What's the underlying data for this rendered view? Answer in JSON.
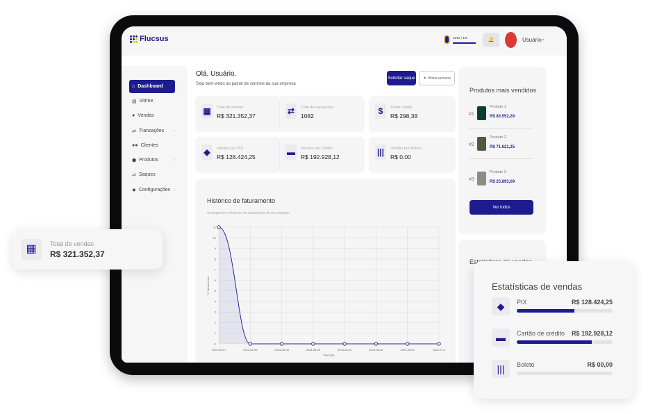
{
  "app": {
    "name": "Flucsus"
  },
  "header": {
    "goal": "321K / 1M",
    "goal_progress": 0.321,
    "user": "Usuário"
  },
  "sidebar": {
    "items": [
      {
        "label": "Dashboard",
        "icon": "home-icon",
        "active": true
      },
      {
        "label": "Vitrine",
        "icon": "store-icon"
      },
      {
        "label": "Vendas",
        "icon": "bag-icon"
      },
      {
        "label": "Transações",
        "icon": "transfer-icon",
        "expandable": true
      },
      {
        "label": "Clientes",
        "icon": "users-icon"
      },
      {
        "label": "Produtos",
        "icon": "box-icon",
        "expandable": true
      },
      {
        "label": "Saques",
        "icon": "transfer-icon"
      },
      {
        "label": "Configurações",
        "icon": "gear-icon",
        "expandable": true
      }
    ]
  },
  "main": {
    "greeting": "Olá, Usuário.",
    "subtitle": "Seja bem-vindo ao painel de controle da sua empresa",
    "withdraw_label": "Solicitar saque",
    "filter_label": "Última semana",
    "stats": [
      {
        "label": "Total de vendas",
        "value": "R$ 321.352,37",
        "icon": "cash-register-icon"
      },
      {
        "label": "Total de transações",
        "value": "1082",
        "icon": "transfer-icon"
      },
      {
        "label": "Ticket médio",
        "value": "R$ 298,38",
        "icon": "dollar-icon"
      },
      {
        "label": "Vendas por PIX",
        "value": "R$ 128.424,25",
        "icon": "pix-icon"
      },
      {
        "label": "Vendas por Cartão",
        "value": "R$ 192.928,12",
        "icon": "credit-card-icon"
      },
      {
        "label": "Vendas por Boleto",
        "value": "R$ 0.00",
        "icon": "barcode-icon"
      }
    ]
  },
  "chart_data": {
    "type": "line",
    "title": "Histórico de faturamento",
    "subtitle": "Acompanhe o histórico de transações do seu negócio",
    "xlabel": "Período",
    "ylabel": "Nº faturamento",
    "x": [
      "2024-08-07",
      "2024-08-06",
      "2024-08-05",
      "2024-08-04",
      "2024-08-03",
      "2024-08-02",
      "2024-08-01",
      "2024-07-3"
    ],
    "values": [
      11,
      0,
      0,
      0,
      0,
      0,
      0,
      0
    ],
    "ylim": [
      0,
      11
    ],
    "yticks": [
      0,
      1,
      2,
      3,
      4,
      5,
      6,
      7,
      8,
      9,
      10,
      11
    ],
    "grid": true,
    "color": "#2a2596"
  },
  "top_products": {
    "title": "Produtos mais vendidos",
    "button": "Ver todos",
    "items": [
      {
        "rank": "#1",
        "name": "Produto 1",
        "price": "R$ 83.552,28"
      },
      {
        "rank": "#2",
        "name": "Produto 2",
        "price": "R$ 71.621,35"
      },
      {
        "rank": "#3",
        "name": "Produto 3",
        "price": "R$ 25.893,09"
      }
    ]
  },
  "float_total": {
    "label": "Total de vendas",
    "value": "R$ 321.352,37"
  },
  "sales_stats": {
    "title": "Estatísticas de vendas",
    "title_partial": "Estatísticas de vendas",
    "items": [
      {
        "label": "PIX",
        "value": "R$ 128.424,25",
        "fraction": 0.6,
        "icon": "pix-icon"
      },
      {
        "label": "Cartão de crédito",
        "value": "R$ 192.928,12",
        "fraction": 0.78,
        "icon": "credit-card-icon"
      },
      {
        "label": "Boleto",
        "value": "R$ 00,00",
        "fraction": 0,
        "icon": "barcode-icon"
      }
    ]
  },
  "colors": {
    "accent": "#1e1b8f"
  }
}
